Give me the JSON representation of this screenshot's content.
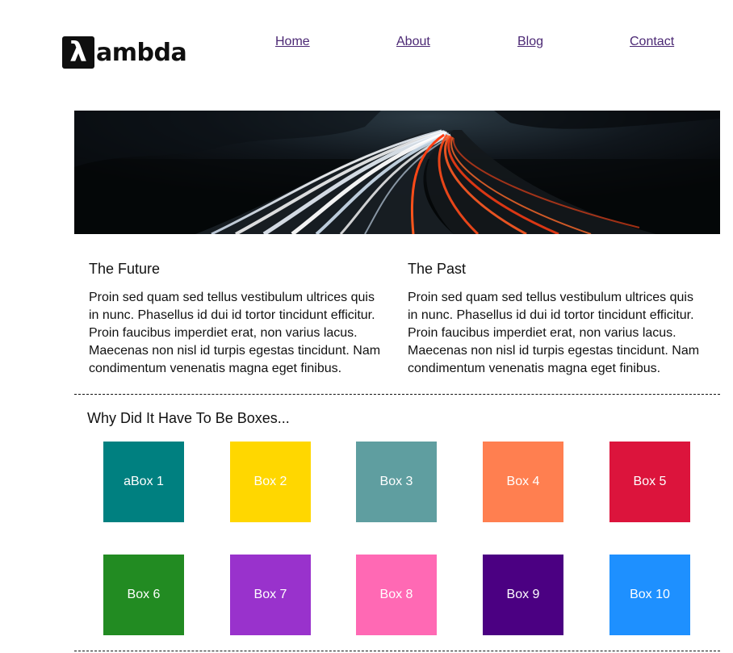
{
  "logo": {
    "glyph": "λ",
    "text": "ambda"
  },
  "nav": [
    {
      "label": "Home"
    },
    {
      "label": "About"
    },
    {
      "label": "Blog"
    },
    {
      "label": "Contact"
    }
  ],
  "columns": [
    {
      "heading": "The Future",
      "body": "Proin sed quam sed tellus vestibulum ultrices quis in nunc. Phasellus id dui id tortor tincidunt efficitur. Proin faucibus imperdiet erat, non varius lacus. Maecenas non nisl id turpis egestas tincidunt. Nam condimentum venenatis magna eget finibus."
    },
    {
      "heading": "The Past",
      "body": "Proin sed quam sed tellus vestibulum ultrices quis in nunc. Phasellus id dui id tortor tincidunt efficitur. Proin faucibus imperdiet erat, non varius lacus. Maecenas non nisl id turpis egestas tincidunt. Nam condimentum venenatis magna eget finibus."
    }
  ],
  "boxes_section": {
    "title": "Why Did It Have To Be Boxes...",
    "boxes": [
      {
        "label": "aBox 1",
        "color": "#008080"
      },
      {
        "label": "Box 2",
        "color": "#FFD700"
      },
      {
        "label": "Box 3",
        "color": "#5F9EA0"
      },
      {
        "label": "Box 4",
        "color": "#FF7F50"
      },
      {
        "label": "Box 5",
        "color": "#DC143C"
      },
      {
        "label": "Box 6",
        "color": "#228B22"
      },
      {
        "label": "Box 7",
        "color": "#9932CC"
      },
      {
        "label": "Box 8",
        "color": "#FF69B4"
      },
      {
        "label": "Box 9",
        "color": "#4B0082"
      },
      {
        "label": "Box 10",
        "color": "#1E90FF"
      }
    ]
  },
  "colors": {
    "link": "#4b2874",
    "text": "#111111"
  }
}
